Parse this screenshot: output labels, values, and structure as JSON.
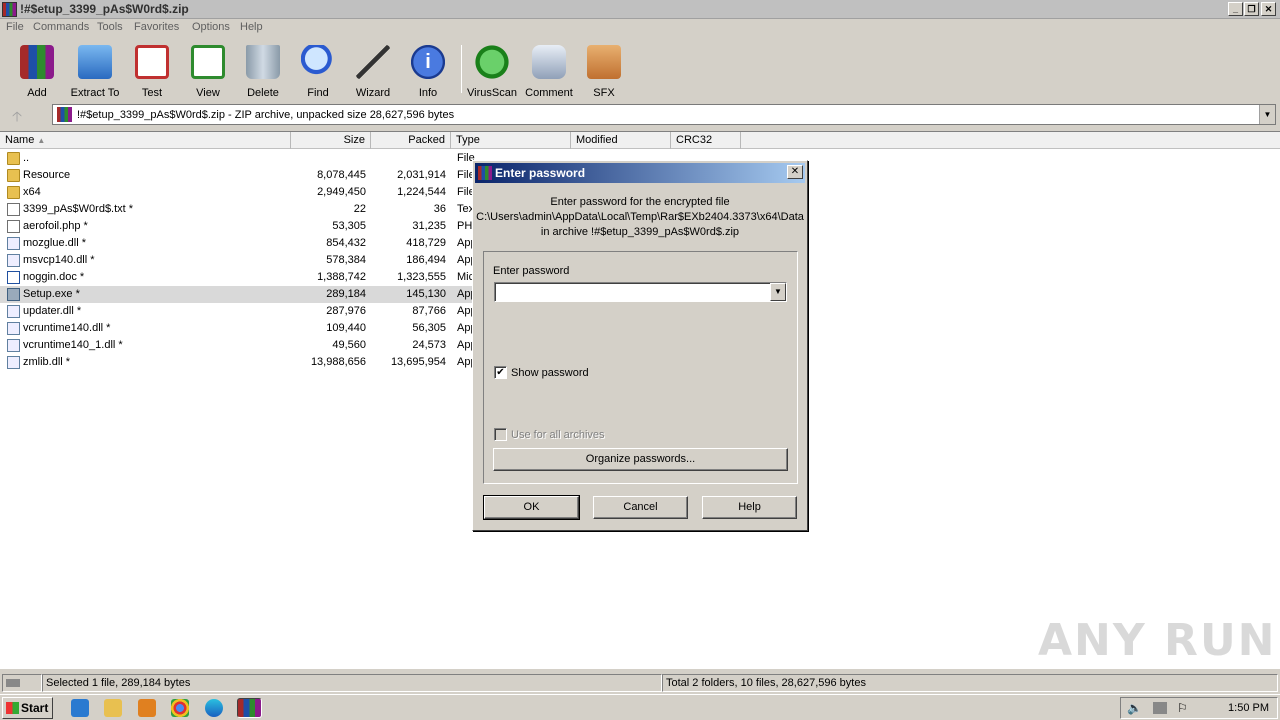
{
  "window": {
    "title": "!#$etup_3399_pAs$W0rd$.zip"
  },
  "menu": [
    "File",
    "Commands",
    "Tools",
    "Favorites",
    "Options",
    "Help"
  ],
  "toolbar": [
    {
      "label": "Add",
      "icon": "add-archive-icon",
      "color": "#c03030"
    },
    {
      "label": "Extract To",
      "icon": "extract-folder-icon",
      "color": "#3a7bd5"
    },
    {
      "label": "Test",
      "icon": "test-clipboard-icon",
      "color": "#cc3333"
    },
    {
      "label": "View",
      "icon": "view-book-icon",
      "color": "#3a9a3a"
    },
    {
      "label": "Delete",
      "icon": "trash-icon",
      "color": "#8a9aa8"
    },
    {
      "label": "Find",
      "icon": "magnifier-icon",
      "color": "#3a6ad0"
    },
    {
      "label": "Wizard",
      "icon": "wand-icon",
      "color": "#909090"
    },
    {
      "label": "Info",
      "icon": "info-icon",
      "color": "#2a5ad0"
    },
    {
      "label": "VirusScan",
      "icon": "virus-scan-icon",
      "color": "#2aa02a"
    },
    {
      "label": "Comment",
      "icon": "comment-icon",
      "color": "#90a0b8"
    },
    {
      "label": "SFX",
      "icon": "sfx-box-icon",
      "color": "#d07a30"
    }
  ],
  "address": {
    "text": "!#$etup_3399_pAs$W0rd$.zip - ZIP archive, unpacked size 28,627,596 bytes"
  },
  "columns": {
    "name": "Name",
    "size": "Size",
    "packed": "Packed",
    "type": "Type",
    "modified": "Modified",
    "crc": "CRC32"
  },
  "files": [
    {
      "name": "..",
      "size": "",
      "packed": "",
      "type": "File folder",
      "icon": "folder"
    },
    {
      "name": "Resource",
      "size": "8,078,445",
      "packed": "2,031,914",
      "type": "File folder",
      "icon": "folder"
    },
    {
      "name": "x64",
      "size": "2,949,450",
      "packed": "1,224,544",
      "type": "File folder",
      "icon": "folder"
    },
    {
      "name": "3399_pAs$W0rd$.txt *",
      "size": "22",
      "packed": "36",
      "type": "Text Document",
      "icon": "txt"
    },
    {
      "name": "aerofoil.php *",
      "size": "53,305",
      "packed": "31,235",
      "type": "PHP File",
      "icon": "txt"
    },
    {
      "name": "mozglue.dll *",
      "size": "854,432",
      "packed": "418,729",
      "type": "Application extension",
      "icon": "dll"
    },
    {
      "name": "msvcp140.dll *",
      "size": "578,384",
      "packed": "186,494",
      "type": "Application extension",
      "icon": "dll"
    },
    {
      "name": "noggin.doc *",
      "size": "1,388,742",
      "packed": "1,323,555",
      "type": "Microsoft Word",
      "icon": "doc"
    },
    {
      "name": "Setup.exe *",
      "size": "289,184",
      "packed": "145,130",
      "type": "Application",
      "icon": "exe",
      "selected": true
    },
    {
      "name": "updater.dll *",
      "size": "287,976",
      "packed": "87,766",
      "type": "Application extension",
      "icon": "dll"
    },
    {
      "name": "vcruntime140.dll *",
      "size": "109,440",
      "packed": "56,305",
      "type": "Application extension",
      "icon": "dll"
    },
    {
      "name": "vcruntime140_1.dll *",
      "size": "49,560",
      "packed": "24,573",
      "type": "Application extension",
      "icon": "dll"
    },
    {
      "name": "zmlib.dll *",
      "size": "13,988,656",
      "packed": "13,695,954",
      "type": "Application extension",
      "icon": "dll"
    }
  ],
  "status": {
    "left": "Selected 1 file, 289,184 bytes",
    "right": "Total 2 folders, 10 files, 28,627,596 bytes"
  },
  "taskbar": {
    "start": "Start",
    "clock": "1:50 PM"
  },
  "dialog": {
    "title": "Enter password",
    "msg1": "Enter password for the encrypted file",
    "msg2": "C:\\Users\\admin\\AppData\\Local\\Temp\\Rar$EXb2404.3373\\x64\\Data",
    "msg3": "in archive !#$etup_3399_pAs$W0rd$.zip",
    "pw_label": "Enter password",
    "pw_value": "",
    "show_password": "Show password",
    "use_all": "Use for all archives",
    "organize": "Organize passwords...",
    "ok": "OK",
    "cancel": "Cancel",
    "help": "Help"
  },
  "watermark": "ANY RUN"
}
